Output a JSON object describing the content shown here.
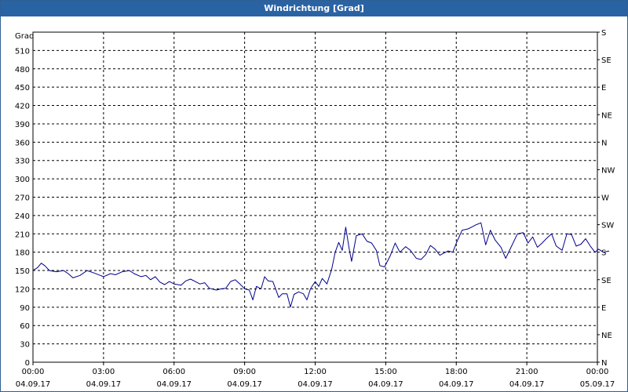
{
  "window": {
    "title": "Windrichtung [Grad]"
  },
  "chart_data": {
    "type": "line",
    "title": "Windrichtung [Grad]",
    "ylabel": "Grad",
    "ylim": [
      0,
      540
    ],
    "xlim_hours": [
      0,
      24
    ],
    "grid": true,
    "line_color": "#00008b",
    "y_ticks": [
      0,
      30,
      60,
      90,
      120,
      150,
      180,
      210,
      240,
      270,
      300,
      330,
      360,
      390,
      420,
      450,
      480,
      510
    ],
    "right_ticks": [
      {
        "value": 0,
        "label": "N"
      },
      {
        "value": 45,
        "label": "NE"
      },
      {
        "value": 90,
        "label": "E"
      },
      {
        "value": 135,
        "label": "SE"
      },
      {
        "value": 180,
        "label": "S"
      },
      {
        "value": 225,
        "label": "SW"
      },
      {
        "value": 270,
        "label": "W"
      },
      {
        "value": 315,
        "label": "NW"
      },
      {
        "value": 360,
        "label": "N"
      },
      {
        "value": 405,
        "label": "NE"
      },
      {
        "value": 450,
        "label": "E"
      },
      {
        "value": 495,
        "label": "SE"
      },
      {
        "value": 540,
        "label": "S"
      }
    ],
    "x_ticks": [
      {
        "hour": 0,
        "time": "00:00",
        "date": "04.09.17"
      },
      {
        "hour": 3,
        "time": "03:00",
        "date": "04.09.17"
      },
      {
        "hour": 6,
        "time": "06:00",
        "date": "04.09.17"
      },
      {
        "hour": 9,
        "time": "09:00",
        "date": "04.09.17"
      },
      {
        "hour": 12,
        "time": "12:00",
        "date": "04.09.17"
      },
      {
        "hour": 15,
        "time": "15:00",
        "date": "04.09.17"
      },
      {
        "hour": 18,
        "time": "18:00",
        "date": "04.09.17"
      },
      {
        "hour": 21,
        "time": "21:00",
        "date": "04.09.17"
      },
      {
        "hour": 24,
        "time": "00:00",
        "date": "05.09.17"
      }
    ],
    "series": [
      {
        "values": [
          [
            0.0,
            150
          ],
          [
            0.2,
            155
          ],
          [
            0.35,
            162
          ],
          [
            0.5,
            158
          ],
          [
            0.7,
            150
          ],
          [
            1.0,
            148
          ],
          [
            1.3,
            150
          ],
          [
            1.5,
            145
          ],
          [
            1.7,
            138
          ],
          [
            2.0,
            142
          ],
          [
            2.3,
            150
          ],
          [
            2.6,
            146
          ],
          [
            3.0,
            140
          ],
          [
            3.3,
            145
          ],
          [
            3.5,
            143
          ],
          [
            3.8,
            148
          ],
          [
            4.1,
            150
          ],
          [
            4.3,
            145
          ],
          [
            4.6,
            140
          ],
          [
            4.8,
            142
          ],
          [
            5.0,
            135
          ],
          [
            5.2,
            140
          ],
          [
            5.4,
            131
          ],
          [
            5.6,
            127
          ],
          [
            5.8,
            132
          ],
          [
            6.0,
            128
          ],
          [
            6.3,
            126
          ],
          [
            6.5,
            133
          ],
          [
            6.7,
            136
          ],
          [
            6.9,
            132
          ],
          [
            7.1,
            128
          ],
          [
            7.3,
            130
          ],
          [
            7.5,
            121
          ],
          [
            7.8,
            118
          ],
          [
            8.0,
            120
          ],
          [
            8.2,
            121
          ],
          [
            8.4,
            132
          ],
          [
            8.6,
            135
          ],
          [
            8.8,
            128
          ],
          [
            9.0,
            120
          ],
          [
            9.2,
            118
          ],
          [
            9.35,
            102
          ],
          [
            9.5,
            124
          ],
          [
            9.7,
            120
          ],
          [
            9.85,
            140
          ],
          [
            10.0,
            133
          ],
          [
            10.2,
            132
          ],
          [
            10.45,
            106
          ],
          [
            10.6,
            112
          ],
          [
            10.8,
            112
          ],
          [
            10.95,
            90
          ],
          [
            11.1,
            111
          ],
          [
            11.3,
            115
          ],
          [
            11.5,
            112
          ],
          [
            11.65,
            102
          ],
          [
            11.8,
            120
          ],
          [
            12.0,
            132
          ],
          [
            12.15,
            124
          ],
          [
            12.3,
            137
          ],
          [
            12.5,
            128
          ],
          [
            12.7,
            152
          ],
          [
            12.85,
            180
          ],
          [
            13.0,
            196
          ],
          [
            13.15,
            183
          ],
          [
            13.3,
            221
          ],
          [
            13.45,
            185
          ],
          [
            13.55,
            165
          ],
          [
            13.75,
            207
          ],
          [
            14.0,
            210
          ],
          [
            14.2,
            198
          ],
          [
            14.4,
            195
          ],
          [
            14.6,
            183
          ],
          [
            14.75,
            158
          ],
          [
            14.95,
            156
          ],
          [
            15.2,
            175
          ],
          [
            15.4,
            195
          ],
          [
            15.6,
            180
          ],
          [
            15.85,
            189
          ],
          [
            16.05,
            183
          ],
          [
            16.3,
            170
          ],
          [
            16.5,
            168
          ],
          [
            16.7,
            176
          ],
          [
            16.9,
            191
          ],
          [
            17.1,
            185
          ],
          [
            17.3,
            175
          ],
          [
            17.45,
            178
          ],
          [
            17.65,
            182
          ],
          [
            17.85,
            180
          ],
          [
            18.0,
            195
          ],
          [
            18.25,
            216
          ],
          [
            18.5,
            218
          ],
          [
            18.7,
            222
          ],
          [
            18.85,
            225
          ],
          [
            19.05,
            228
          ],
          [
            19.25,
            192
          ],
          [
            19.45,
            216
          ],
          [
            19.65,
            200
          ],
          [
            19.9,
            188
          ],
          [
            20.1,
            170
          ],
          [
            20.35,
            190
          ],
          [
            20.6,
            210
          ],
          [
            20.85,
            212
          ],
          [
            21.05,
            195
          ],
          [
            21.25,
            205
          ],
          [
            21.45,
            188
          ],
          [
            21.65,
            195
          ],
          [
            21.85,
            203
          ],
          [
            22.05,
            210
          ],
          [
            22.25,
            190
          ],
          [
            22.5,
            183
          ],
          [
            22.7,
            210
          ],
          [
            22.9,
            209
          ],
          [
            23.1,
            190
          ],
          [
            23.3,
            193
          ],
          [
            23.5,
            202
          ],
          [
            23.7,
            190
          ],
          [
            23.9,
            180
          ],
          [
            24.05,
            185
          ],
          [
            24.25,
            180
          ],
          [
            24.5,
            182
          ]
        ]
      }
    ]
  }
}
